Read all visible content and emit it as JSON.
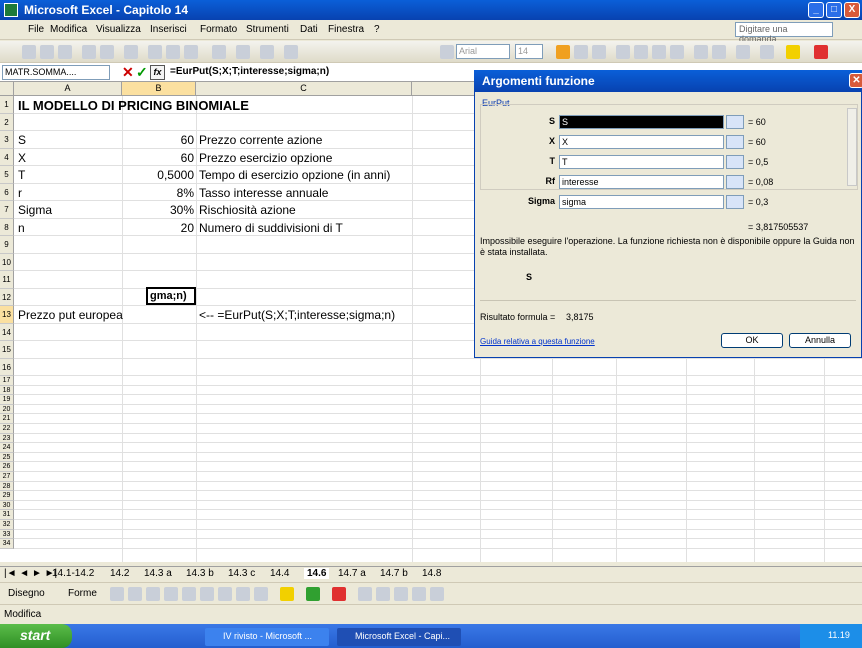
{
  "window": {
    "title": "Microsoft Excel - Capitolo 14",
    "min": "_",
    "max": "□",
    "close": "X"
  },
  "menu": {
    "items": [
      "File",
      "Modifica",
      "Visualizza",
      "Inserisci",
      "Formato",
      "Strumenti",
      "Dati",
      "Finestra",
      "?"
    ],
    "ask_placeholder": "Digitare una domanda."
  },
  "toolbar": {
    "font": "Arial",
    "size": "14"
  },
  "formula_bar": {
    "name_box": "MATR.SOMMA....",
    "formula": "=EurPut(S;X;T;interesse;sigma;n)",
    "fx": "fx"
  },
  "columns": [
    "A",
    "B",
    "C"
  ],
  "rows": [
    {
      "n": "1",
      "a": "IL MODELLO DI PRICING BINOMIALE",
      "b": "",
      "c": ""
    },
    {
      "n": "2",
      "a": "",
      "b": "",
      "c": ""
    },
    {
      "n": "3",
      "a": "S",
      "b": "60",
      "c": "Prezzo corrente azione"
    },
    {
      "n": "4",
      "a": "X",
      "b": "60",
      "c": "Prezzo esercizio opzione"
    },
    {
      "n": "5",
      "a": "T",
      "b": "0,5000",
      "c": "Tempo di esercizio opzione (in anni)"
    },
    {
      "n": "6",
      "a": "r",
      "b": "8%",
      "c": "Tasso interesse annuale"
    },
    {
      "n": "7",
      "a": "Sigma",
      "b": "30%",
      "c": "Rischiosità azione"
    },
    {
      "n": "8",
      "a": "n",
      "b": "20",
      "c": "Numero di suddivisioni di T"
    },
    {
      "n": "9",
      "a": "",
      "b": "",
      "c": ""
    },
    {
      "n": "10",
      "a": "",
      "b": "",
      "c": ""
    },
    {
      "n": "11",
      "a": "",
      "b": "",
      "c": ""
    },
    {
      "n": "12",
      "a": "",
      "b": "",
      "c": ""
    },
    {
      "n": "13",
      "a": "Prezzo put europea",
      "b": "gma;n)",
      "c": "<-- =EurPut(S;X;T;interesse;sigma;n)"
    },
    {
      "n": "14",
      "a": "",
      "b": "",
      "c": ""
    },
    {
      "n": "15",
      "a": "",
      "b": "",
      "c": ""
    },
    {
      "n": "16",
      "a": "",
      "b": "",
      "c": ""
    }
  ],
  "small_rows": [
    "17",
    "18",
    "19",
    "20",
    "21",
    "22",
    "23",
    "24",
    "25",
    "26",
    "27",
    "28",
    "29",
    "30",
    "31",
    "32",
    "33",
    "34"
  ],
  "sheet_tabs": [
    "14.1-14.2",
    "14.2",
    "14.3 a",
    "14.3 b",
    "14.3 c",
    "14.4",
    "14.6",
    "14.7 a",
    "14.7 b",
    "14.8"
  ],
  "active_tab": "14.6",
  "drawbar": {
    "disegno": "Disegno",
    "forme": "Forme"
  },
  "status": "Modifica",
  "taskbar": {
    "start": "start",
    "tasks": [
      "IV rivisto - Microsoft ...",
      "Microsoft Excel - Capi..."
    ],
    "clock": "11.19"
  },
  "dialog": {
    "title": "Argomenti funzione",
    "group": "EurPut",
    "args": [
      {
        "label": "S",
        "value": "S",
        "result": "= 60"
      },
      {
        "label": "X",
        "value": "X",
        "result": "= 60"
      },
      {
        "label": "T",
        "value": "T",
        "result": "= 0,5"
      },
      {
        "label": "Rf",
        "value": "interesse",
        "result": "= 0,08"
      },
      {
        "label": "Sigma",
        "value": "sigma",
        "result": "= 0,3"
      }
    ],
    "total": "= 3,817505537",
    "message": "Impossibile eseguire l'operazione.  La funzione richiesta non è disponibile oppure la Guida non è stata installata.",
    "current_arg": "S",
    "result_label": "Risultato formula =",
    "result_value": "3,8175",
    "help": "Guida relativa a questa funzione",
    "ok": "OK",
    "cancel": "Annulla"
  }
}
